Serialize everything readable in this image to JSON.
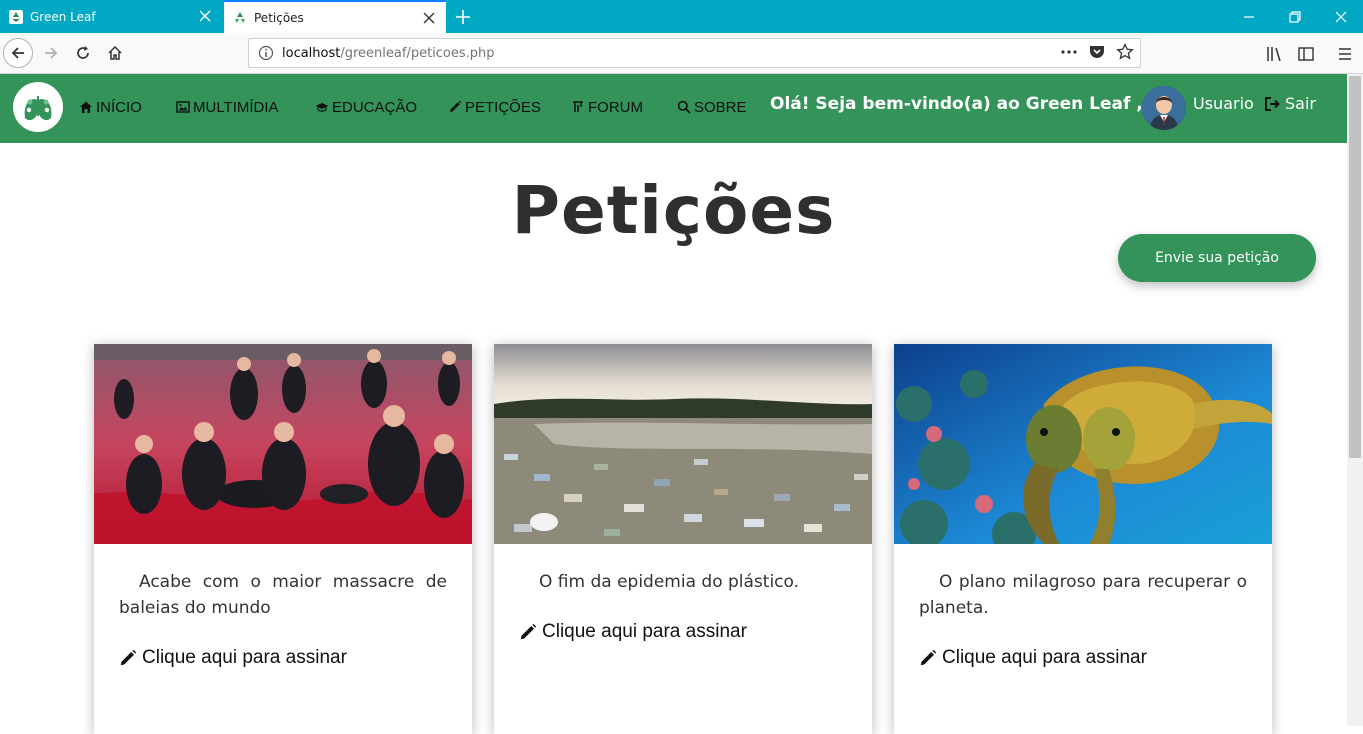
{
  "browser": {
    "tabs": [
      {
        "title": "Green Leaf",
        "active": false
      },
      {
        "title": "Petições",
        "active": true
      }
    ],
    "url_host": "localhost",
    "url_path": "/greenleaf/peticoes.php"
  },
  "header": {
    "menu": [
      {
        "icon": "home-icon",
        "label": "INÍCIO"
      },
      {
        "icon": "image-icon",
        "label": "MULTIMÍDIA"
      },
      {
        "icon": "graduation-cap-icon",
        "label": "EDUCAÇÃO"
      },
      {
        "icon": "pencil-icon",
        "label": "PETIÇÕES"
      },
      {
        "icon": "forum-icon",
        "label": "FORUM"
      },
      {
        "icon": "search-icon",
        "label": "SOBRE"
      }
    ],
    "welcome": "Olá! Seja bem-vindo(a) ao Green Leaf ,",
    "username": "Usuario",
    "logout_label": "Sair"
  },
  "page": {
    "title": "Petições",
    "send_button": "Envie sua petição"
  },
  "cards": [
    {
      "text": "Acabe com o maior massacre de baleias do mundo",
      "sign_label": "Clique aqui para assinar",
      "image": "whale-hunt-photo"
    },
    {
      "text": "O fim da epidemia do plástico.",
      "sign_label": "Clique aqui para assinar",
      "image": "plastic-pollution-photo"
    },
    {
      "text": "O plano milagroso para recuperar o planeta.",
      "sign_label": "Clique aqui para assinar",
      "image": "sea-turtles-photo"
    }
  ],
  "colors": {
    "tabstrip": "#00a8c4",
    "header_green": "#339359",
    "button_green": "#339359"
  }
}
